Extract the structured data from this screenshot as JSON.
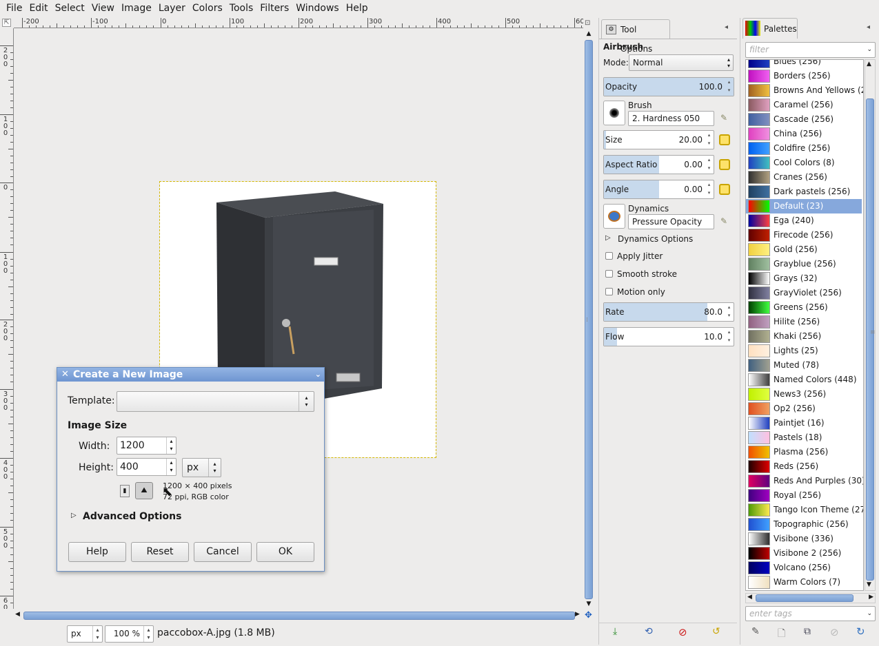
{
  "menu": [
    "File",
    "Edit",
    "Select",
    "View",
    "Image",
    "Layer",
    "Colors",
    "Tools",
    "Filters",
    "Windows",
    "Help"
  ],
  "ruler_h": [
    "-200",
    "-100",
    "0",
    "100",
    "200",
    "300",
    "400",
    "500",
    "60"
  ],
  "ruler_v": [
    "2\n0\n0",
    "1\n0\n0",
    "0",
    "1\n0\n0",
    "2\n0\n0",
    "3\n0\n0",
    "4\n0\n0",
    "5\n0\n0",
    "6\n0\n0"
  ],
  "status": {
    "unit": "px",
    "zoom": "100 %",
    "file": "paccobox-A.jpg (1.8 MB)"
  },
  "tool_options": {
    "tab_title": "Tool Options",
    "tool": "Airbrush",
    "mode_label": "Mode:",
    "mode_value": "Normal",
    "opacity_label": "Opacity",
    "opacity_value": "100.0",
    "opacity_frac": 1.0,
    "brush_label": "Brush",
    "brush_value": "2. Hardness 050",
    "size_label": "Size",
    "size_value": "20.00",
    "size_frac": 0.02,
    "aspect_label": "Aspect Ratio",
    "aspect_value": "0.00",
    "aspect_frac": 0.5,
    "angle_label": "Angle",
    "angle_value": "0.00",
    "angle_frac": 0.5,
    "dynamics_label": "Dynamics",
    "dynamics_value": "Pressure Opacity",
    "dynamics_options": "Dynamics Options",
    "apply_jitter": "Apply Jitter",
    "smooth_stroke": "Smooth stroke",
    "motion_only": "Motion only",
    "rate_label": "Rate",
    "rate_value": "80.0",
    "rate_frac": 0.8,
    "flow_label": "Flow",
    "flow_value": "10.0",
    "flow_frac": 0.1
  },
  "palettes": {
    "tab_title": "Palettes",
    "filter_placeholder": "filter",
    "tags_placeholder": "enter tags",
    "selected": "Default (23)",
    "items": [
      {
        "name": "Blues (256)",
        "colors": [
          "#00008b",
          "#2040c0"
        ]
      },
      {
        "name": "Borders (256)",
        "colors": [
          "#c010c0",
          "#f060f0"
        ]
      },
      {
        "name": "Browns And Yellows (2",
        "colors": [
          "#a06020",
          "#f0c040"
        ]
      },
      {
        "name": "Caramel (256)",
        "colors": [
          "#8a5a60",
          "#e0a0c0"
        ]
      },
      {
        "name": "Cascade (256)",
        "colors": [
          "#4060a0",
          "#8090c0"
        ]
      },
      {
        "name": "China (256)",
        "colors": [
          "#e040c0",
          "#f090e0"
        ]
      },
      {
        "name": "Coldfire (256)",
        "colors": [
          "#0060f0",
          "#40a0ff"
        ]
      },
      {
        "name": "Cool Colors (8)",
        "colors": [
          "#2040c0",
          "#40c0c0"
        ]
      },
      {
        "name": "Cranes (256)",
        "colors": [
          "#303030",
          "#b0a080"
        ]
      },
      {
        "name": "Dark pastels (256)",
        "colors": [
          "#204060",
          "#4070a0"
        ]
      },
      {
        "name": "Default (23)",
        "colors": [
          "#ff0000",
          "#00ff00"
        ]
      },
      {
        "name": "Ega (240)",
        "colors": [
          "#0000a0",
          "#ff4040"
        ]
      },
      {
        "name": "Firecode (256)",
        "colors": [
          "#600000",
          "#c02000"
        ]
      },
      {
        "name": "Gold (256)",
        "colors": [
          "#f0d040",
          "#fff080"
        ]
      },
      {
        "name": "Grayblue (256)",
        "colors": [
          "#608060",
          "#a0c0a0"
        ]
      },
      {
        "name": "Grays (32)",
        "colors": [
          "#000000",
          "#ffffff"
        ]
      },
      {
        "name": "GrayViolet (256)",
        "colors": [
          "#303040",
          "#8080a0"
        ]
      },
      {
        "name": "Greens (256)",
        "colors": [
          "#004000",
          "#40ff40"
        ]
      },
      {
        "name": "Hilite (256)",
        "colors": [
          "#906080",
          "#c0a0c0"
        ]
      },
      {
        "name": "Khaki (256)",
        "colors": [
          "#707060",
          "#b0b090"
        ]
      },
      {
        "name": "Lights (25)",
        "colors": [
          "#ffe0c0",
          "#fff0e0"
        ]
      },
      {
        "name": "Muted (78)",
        "colors": [
          "#406080",
          "#a0a090"
        ]
      },
      {
        "name": "Named Colors (448)",
        "colors": [
          "#ffffff",
          "#404040"
        ]
      },
      {
        "name": "News3 (256)",
        "colors": [
          "#c0f000",
          "#e0ff40"
        ]
      },
      {
        "name": "Op2 (256)",
        "colors": [
          "#e05020",
          "#f0a060"
        ]
      },
      {
        "name": "Paintjet (16)",
        "colors": [
          "#ffffff",
          "#2040c0"
        ]
      },
      {
        "name": "Pastels (18)",
        "colors": [
          "#c0e0ff",
          "#ffc0e0"
        ]
      },
      {
        "name": "Plasma (256)",
        "colors": [
          "#f05000",
          "#f0c000"
        ]
      },
      {
        "name": "Reds (256)",
        "colors": [
          "#200000",
          "#e00000"
        ]
      },
      {
        "name": "Reds And Purples (30)",
        "colors": [
          "#e00060",
          "#600080"
        ]
      },
      {
        "name": "Royal (256)",
        "colors": [
          "#400080",
          "#a000c0"
        ]
      },
      {
        "name": "Tango Icon Theme (27)",
        "colors": [
          "#4e9a06",
          "#fce94f"
        ]
      },
      {
        "name": "Topographic (256)",
        "colors": [
          "#2050d0",
          "#40a0ff"
        ]
      },
      {
        "name": "Visibone (336)",
        "colors": [
          "#ffffff",
          "#303030"
        ]
      },
      {
        "name": "Visibone 2 (256)",
        "colors": [
          "#000000",
          "#c00000"
        ]
      },
      {
        "name": "Volcano (256)",
        "colors": [
          "#000060",
          "#0000c0"
        ]
      },
      {
        "name": "Warm Colors (7)",
        "colors": [
          "#ffffff",
          "#f0e0c0"
        ]
      }
    ]
  },
  "dialog": {
    "title": "Create a New Image",
    "template_label": "Template:",
    "template_value": "",
    "image_size": "Image Size",
    "width_label": "Width:",
    "width_value": "1200",
    "height_label": "Height:",
    "height_value": "400",
    "unit": "px",
    "info_line1": "1200 × 400 pixels",
    "info_line2": "72 ppi, RGB color",
    "advanced": "Advanced Options",
    "buttons": {
      "help": "Help",
      "reset": "Reset",
      "cancel": "Cancel",
      "ok": "OK"
    }
  }
}
